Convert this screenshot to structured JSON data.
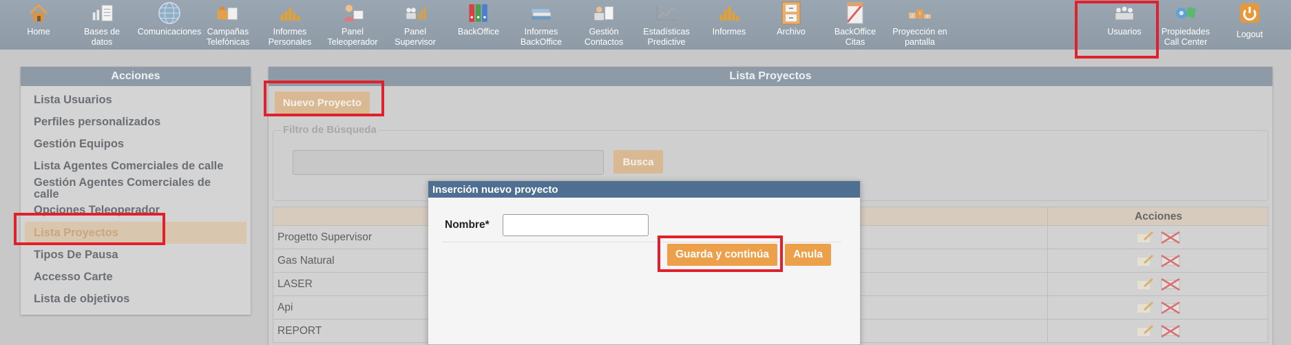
{
  "nav": {
    "items": [
      {
        "label": "Home",
        "icon": "home-icon"
      },
      {
        "label": "Bases de\ndatos",
        "icon": "databases-icon"
      },
      {
        "label": "Comunicaciones",
        "icon": "globe-icon"
      },
      {
        "label": "Campañas\nTelefónicas",
        "icon": "campaigns-icon"
      },
      {
        "label": "Informes\nPersonales",
        "icon": "bar-chart-icon"
      },
      {
        "label": "Panel\nTeleoperador",
        "icon": "operator-icon"
      },
      {
        "label": "Panel\nSupervisor",
        "icon": "supervisor-icon"
      },
      {
        "label": "BackOffice",
        "icon": "binders-icon"
      },
      {
        "label": "Informes\nBackOffice",
        "icon": "books-icon"
      },
      {
        "label": "Gestión\nContactos",
        "icon": "contacts-icon"
      },
      {
        "label": "Estadísticas\nPredictive",
        "icon": "line-chart-icon"
      },
      {
        "label": "Informes",
        "icon": "bar-chart-icon"
      },
      {
        "label": "Archivo",
        "icon": "cabinet-icon"
      },
      {
        "label": "BackOffice\nCitas",
        "icon": "calendar-icon"
      },
      {
        "label": "Proyección en\npantalla",
        "icon": "podium-icon"
      }
    ],
    "right_items": [
      {
        "label": "Usuarios",
        "icon": "users-icon"
      },
      {
        "label": "Propiedades\nCall Center",
        "icon": "gears-icon"
      },
      {
        "label": "Logout",
        "icon": "power-icon"
      }
    ]
  },
  "sidebar": {
    "title": "Acciones",
    "items": [
      "Lista Usuarios",
      "Perfiles personalizados",
      "Gestión Equipos",
      "Lista Agentes Comerciales de calle",
      "Gestión Agentes Comerciales de calle",
      "Opciones Teleoperador",
      "Lista Proyectos",
      "Tipos De Pausa",
      "Accesso Carte",
      "Lista de objetivos"
    ]
  },
  "main": {
    "title": "Lista Proyectos",
    "new_button": "Nuevo Proyecto",
    "filter_legend": "Filtro de Búsqueda",
    "search_placeholder": "",
    "search_button": "Busca",
    "table": {
      "actions_header": "Acciones",
      "rows": [
        "Progetto Supervisor",
        "Gas Natural",
        "LASER",
        "Api",
        "REPORT"
      ]
    }
  },
  "modal": {
    "title": "Inserción nuevo proyecto",
    "name_label": "Nombre*",
    "name_value": "",
    "save_button": "Guarda y continúa",
    "cancel_button": "Anula"
  },
  "colors": {
    "topbar": "#8e9ba6",
    "accent_orange": "#eda04a",
    "modal_header": "#4e6f91",
    "highlight_red": "#e0202a"
  }
}
